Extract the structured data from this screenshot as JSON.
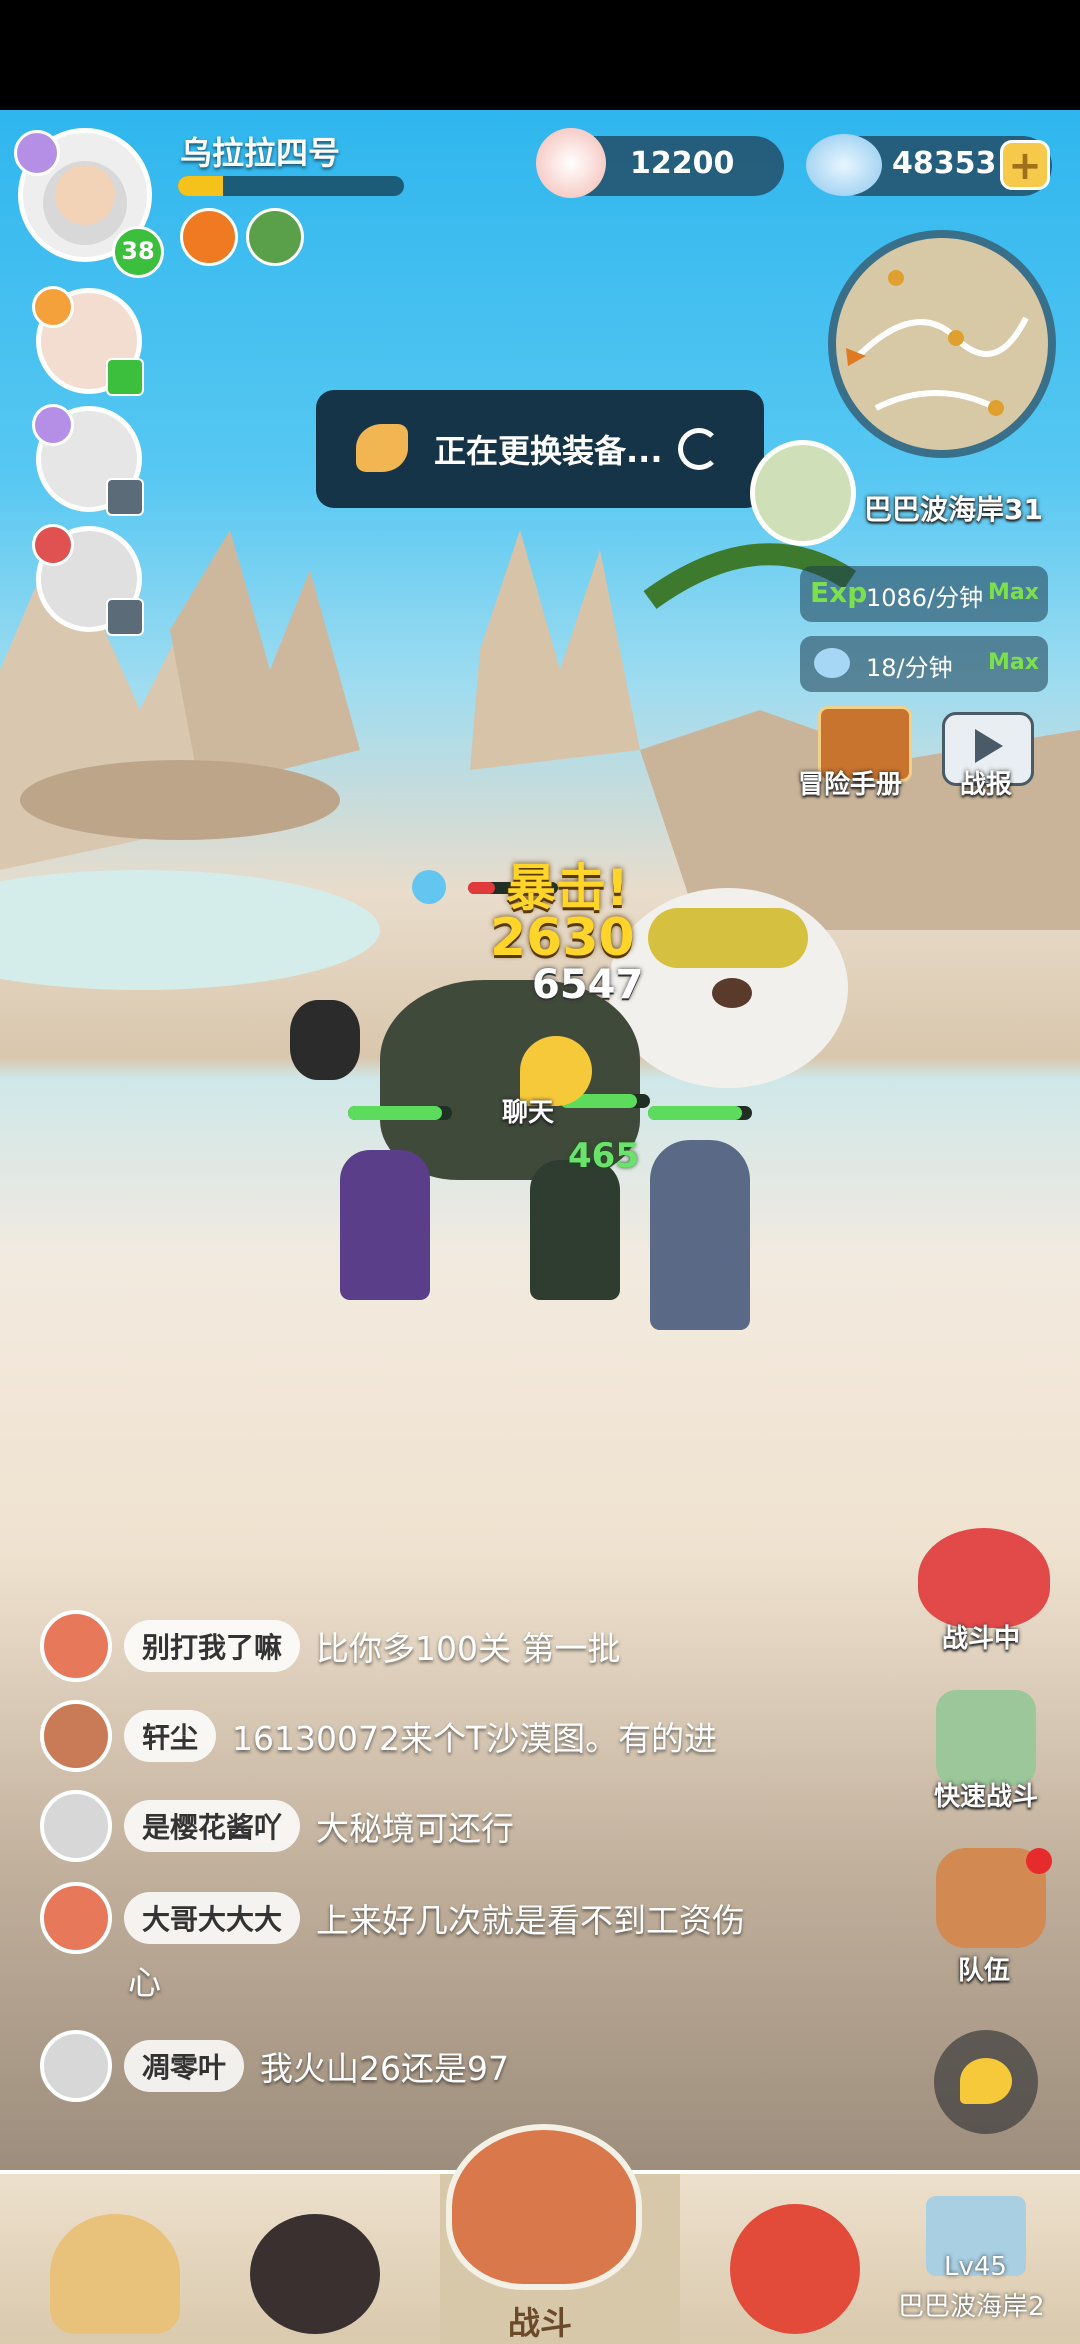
{
  "player": {
    "name": "乌拉拉四号",
    "level": "38",
    "xp_progress": 0.2
  },
  "currency": {
    "pearls": "12200",
    "gems": "48353",
    "add_symbol": "+"
  },
  "toast": {
    "text": "正在更换装备..."
  },
  "location": {
    "name": "巴巴波海岸31"
  },
  "rates": {
    "exp_label": "Exp",
    "exp_value": "1086/分钟",
    "exp_max": "Max",
    "gem_value": "18/分钟",
    "gem_max": "Max"
  },
  "side_buttons": {
    "handbook": "冒险手册",
    "report": "战报"
  },
  "combat": {
    "crit": "暴击!",
    "damage1": "2630",
    "damage2": "6547",
    "heal": "465",
    "chat_bubble_label": "聊天"
  },
  "right_actions": {
    "fighting": "战斗中",
    "quick_battle": "快速战斗",
    "team": "队伍"
  },
  "chat": [
    {
      "name": "别打我了嘛",
      "message": "比你多100关  第一批"
    },
    {
      "name": "轩尘",
      "message": "16130072来个T沙漠图。有的进"
    },
    {
      "name": "是樱花酱吖",
      "message": "大秘境可还行"
    },
    {
      "name": "大哥大大大",
      "message": "上来好几次就是看不到工资伤",
      "message_cont": "心"
    },
    {
      "name": "凋零叶",
      "message": "我火山26还是97"
    }
  ],
  "bottom_nav": {
    "battle": "战斗",
    "lock_level": "Lv45",
    "lock_location": "巴巴波海岸2"
  },
  "colors": {
    "accent_green": "#3cbf3c",
    "xp_yellow": "#f5c21b",
    "toast_bg": "#163447"
  }
}
